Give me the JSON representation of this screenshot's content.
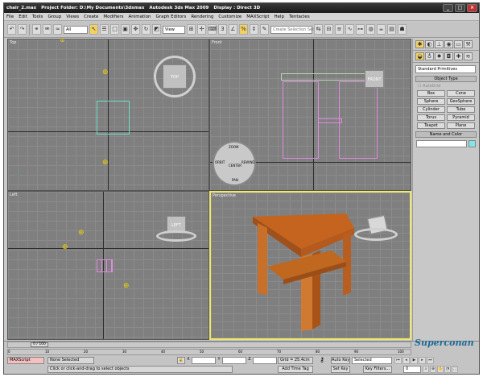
{
  "titlebar": {
    "file": "chair_2.max",
    "project": "Project Folder: D:\\My Documents\\3dsmax",
    "app": "Autodesk 3ds Max 2009",
    "display": "Display : Direct 3D",
    "minimize": "_",
    "maximize": "□",
    "close": "×"
  },
  "menu": [
    "File",
    "Edit",
    "Tools",
    "Group",
    "Views",
    "Create",
    "Modifiers",
    "Animation",
    "Graph Editors",
    "Rendering",
    "Customize",
    "MAXScript",
    "Help",
    "Tentacles"
  ],
  "toolbar": {
    "filter_value": "All",
    "refcoord_value": "View",
    "named_selection_placeholder": "Create Selection Set"
  },
  "viewports": {
    "top": {
      "label": "Top",
      "cube": "TOP"
    },
    "front": {
      "label": "Front",
      "cube": "FRONT"
    },
    "left": {
      "label": "Left",
      "cube": "LEFT"
    },
    "perspective": {
      "label": "Perspective"
    },
    "steering": [
      "ZOOM",
      "ORBIT",
      "PAN",
      "REWIND",
      "CENTER"
    ]
  },
  "command_panel": {
    "dropdown": "Standard Primitives",
    "rollout_object_type": "Object Type",
    "autogrid": "AutoGrid",
    "buttons": [
      "Box",
      "Cone",
      "Sphere",
      "GeoSphere",
      "Cylinder",
      "Tube",
      "Torus",
      "Pyramid",
      "Teapot",
      "Plane"
    ],
    "rollout_name_color": "Name and Color",
    "object_color": "#7fe7e7"
  },
  "status": {
    "frame_counter": "0 / 100",
    "maxscript": "MAXScript",
    "selection": "None Selected",
    "prompt": "Click or click-and-drag to select objects",
    "x_label": "X",
    "y_label": "Y",
    "z_label": "Z",
    "grid": "Grid = 25.4cm",
    "add_time_tag": "Add Time Tag",
    "auto_key": "Auto Key",
    "set_key": "Set Key",
    "key_filters": "Key Filters...",
    "selected": "Selected",
    "current_frame": "0",
    "ruler_ticks": [
      "0",
      "10",
      "20",
      "30",
      "40",
      "50",
      "60",
      "70",
      "80",
      "90",
      "100"
    ]
  },
  "watermark": "Superconan"
}
